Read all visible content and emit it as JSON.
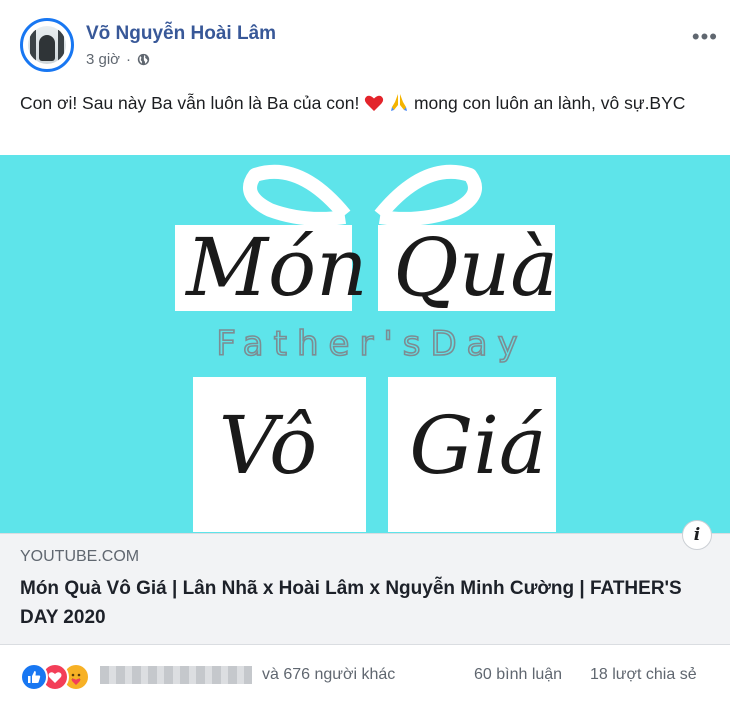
{
  "post": {
    "author": "Võ Nguyễn Hoài Lâm",
    "time": "3 giờ",
    "caption_text": "Con ơi! Sau này Ba vẫn luôn là Ba của con! ",
    "caption_tail": " mong con luôn an lành, vô sự.BYC",
    "privacy_icon": "globe-icon",
    "more_icon": "more-options-icon"
  },
  "thumbnail": {
    "script_line1": "Món Quà",
    "subtitle": "Father'sDay",
    "script_line2_left": "Vô",
    "script_line2_right": "Giá",
    "background_color": "#5ee4ea"
  },
  "link": {
    "domain": "YOUTUBE.COM",
    "title": "Món Quà Vô Giá | Lân Nhã x Hoài Lâm x Nguyễn Minh Cường | FATHER'S DAY 2020",
    "info_label": "i"
  },
  "footer": {
    "reactions": [
      "like-icon",
      "love-icon",
      "care-icon"
    ],
    "others_text": "và 676 người khác",
    "comments_text": "60 bình luận",
    "shares_text": "18 lượt chia sẻ"
  },
  "colors": {
    "author_link": "#385898",
    "like": "#1877f2",
    "love": "#f33e58",
    "care": "#f7b125"
  }
}
